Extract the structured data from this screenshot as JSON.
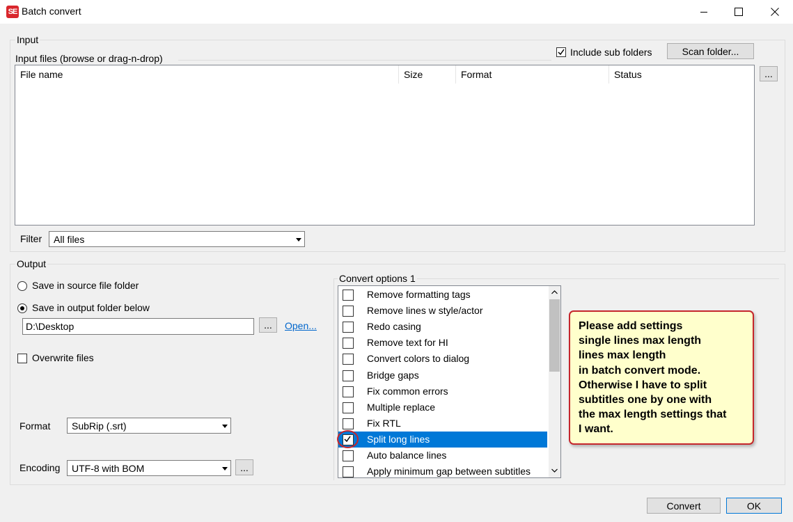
{
  "window": {
    "title": "Batch convert",
    "logo_text": "SE"
  },
  "input": {
    "group_label": "Input",
    "files_label": "Input files (browse or drag-n-drop)",
    "include_sub_folders": {
      "label": "Include sub folders",
      "checked": true
    },
    "scan_folder_label": "Scan folder...",
    "browse_label": "...",
    "columns": [
      "File name",
      "Size",
      "Format",
      "Status"
    ],
    "filter_label": "Filter",
    "filter_value": "All files"
  },
  "output": {
    "group_label": "Output",
    "save_in_source": "Save in source file folder",
    "save_in_output": "Save in output folder below",
    "output_folder": "D:\\Desktop",
    "browse_label": "...",
    "open_label": "Open...",
    "overwrite_label": "Overwrite files",
    "format_label": "Format",
    "format_value": "SubRip (.srt)",
    "encoding_label": "Encoding",
    "encoding_value": "UTF-8 with BOM",
    "encoding_btn": "..."
  },
  "convert_options": {
    "label": "Convert options  1",
    "items": [
      {
        "label": "Remove formatting tags",
        "checked": false
      },
      {
        "label": "Remove lines w style/actor",
        "checked": false
      },
      {
        "label": "Redo casing",
        "checked": false
      },
      {
        "label": "Remove text for HI",
        "checked": false
      },
      {
        "label": "Convert colors to dialog",
        "checked": false
      },
      {
        "label": "Bridge gaps",
        "checked": false
      },
      {
        "label": "Fix common errors",
        "checked": false
      },
      {
        "label": "Multiple replace",
        "checked": false
      },
      {
        "label": "Fix RTL",
        "checked": false
      },
      {
        "label": "Split long lines",
        "checked": true,
        "selected": true
      },
      {
        "label": "Auto balance lines",
        "checked": false
      },
      {
        "label": "Apply minimum gap between subtitles",
        "checked": false
      }
    ]
  },
  "note": {
    "lines": [
      "Please add settings",
      "single lines max length",
      "lines max length",
      "in batch convert mode.",
      "Otherwise I have to split",
      "subtitles one by one with",
      "the max length settings that",
      "I want."
    ]
  },
  "footer": {
    "convert_label": "Convert",
    "ok_label": "OK"
  },
  "colors": {
    "selection": "#0078d7",
    "note_bg": "#ffffcc",
    "highlight_ring": "#c5262c",
    "link": "#0066cc"
  }
}
